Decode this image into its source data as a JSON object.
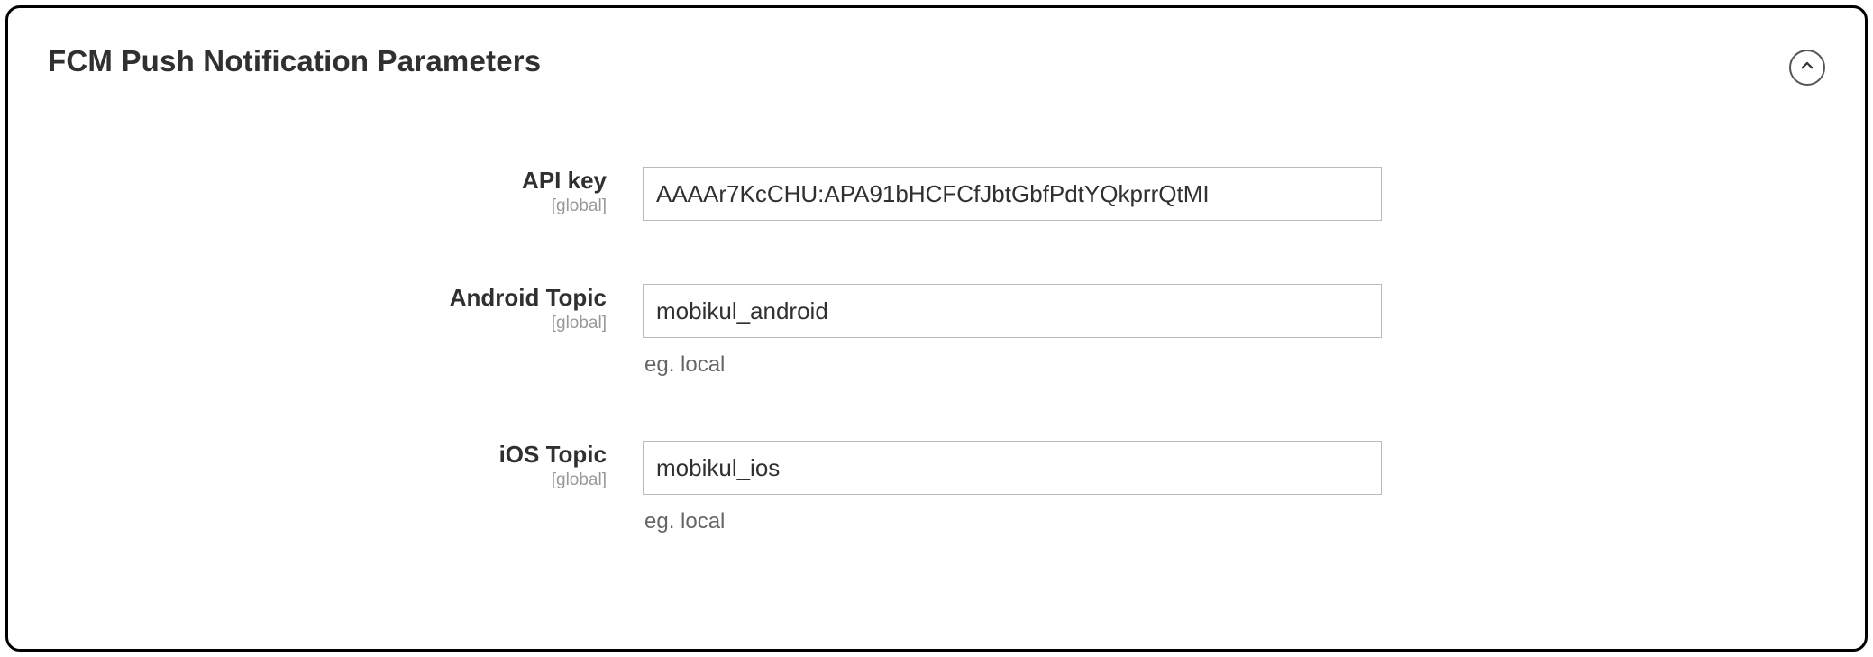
{
  "section": {
    "title": "FCM Push Notification Parameters",
    "scopeLabel": "[global]"
  },
  "fields": {
    "apiKey": {
      "label": "API key",
      "value": "AAAAr7KcCHU:APA91bHCFCfJbtGbfPdtYQkprrQtMI"
    },
    "androidTopic": {
      "label": "Android Topic",
      "value": "mobikul_android",
      "hint": "eg. local"
    },
    "iosTopic": {
      "label": "iOS Topic",
      "value": "mobikul_ios",
      "hint": "eg. local"
    }
  }
}
